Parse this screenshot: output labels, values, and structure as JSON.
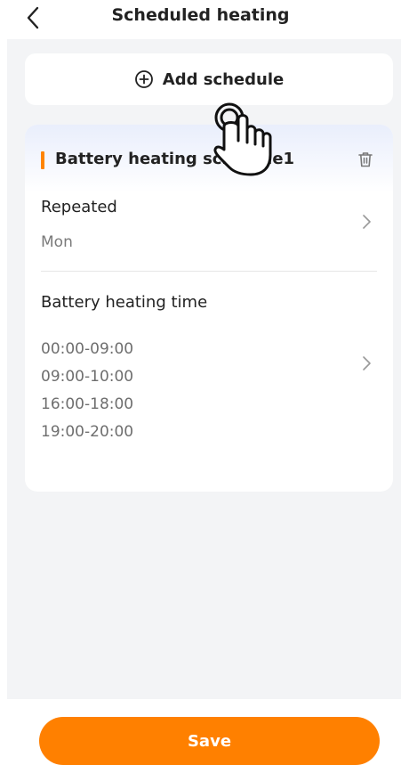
{
  "header": {
    "title": "Scheduled heating",
    "back_icon": "chevron-left-icon"
  },
  "add_schedule": {
    "label": "Add schedule",
    "icon": "plus-circle-icon"
  },
  "schedule": {
    "title": "Battery heating schedule1",
    "delete_icon": "trash-icon",
    "accent_color": "#ff8500",
    "repeated": {
      "label": "Repeated",
      "value": "Mon"
    },
    "heating_time": {
      "label": "Battery heating time",
      "times": [
        "00:00-09:00",
        "09:00-10:00",
        "16:00-18:00",
        "19:00-20:00"
      ]
    }
  },
  "footer": {
    "save_label": "Save",
    "save_color": "#ff8000"
  }
}
